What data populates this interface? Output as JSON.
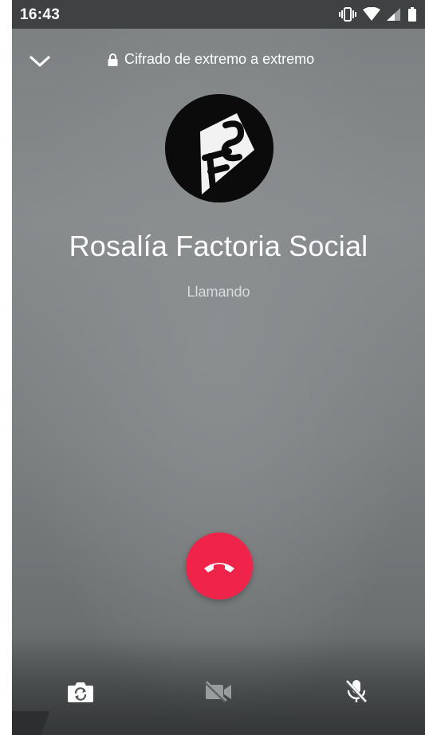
{
  "status_bar": {
    "time": "16:43",
    "icons": [
      "vibrate-icon",
      "wifi-icon",
      "signal-icon",
      "battery-icon"
    ]
  },
  "header": {
    "collapse_icon": "chevron-down-icon",
    "encryption_label": "Cifrado de extremo a extremo",
    "encryption_icon": "lock-icon"
  },
  "contact": {
    "name": "Rosalía Factoria Social",
    "avatar_icon": "contact-avatar"
  },
  "call": {
    "status": "Llamando",
    "end_call_icon": "end-call-icon"
  },
  "controls": [
    {
      "icon": "switch-camera-icon"
    },
    {
      "icon": "video-off-icon"
    },
    {
      "icon": "mic-off-icon"
    }
  ],
  "colors": {
    "end_call": "#f0244a",
    "status_bar": "#3a3c3d",
    "foreground": "#ffffff"
  }
}
